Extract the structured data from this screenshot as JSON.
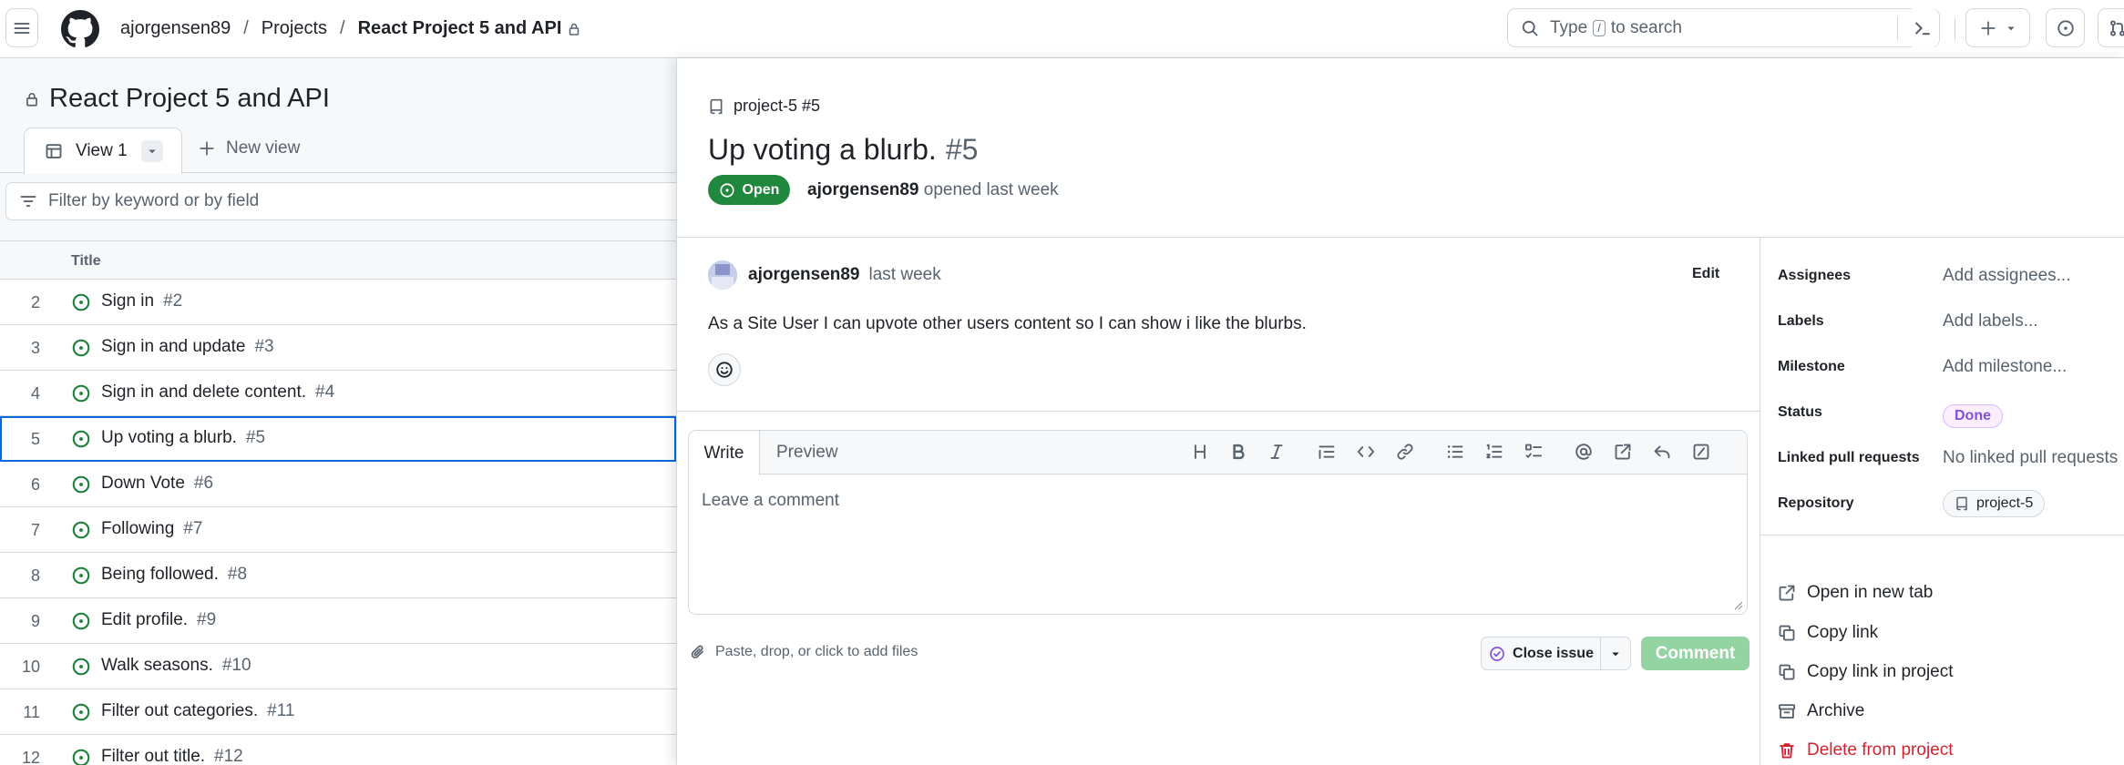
{
  "header": {
    "breadcrumb": {
      "owner": "ajorgensen89",
      "section": "Projects",
      "project": "React Project 5 and API"
    },
    "search": {
      "prefix": "Type",
      "key": "/",
      "suffix": "to search"
    }
  },
  "project": {
    "title": "React Project 5 and API",
    "tabs": {
      "view1": "View 1",
      "new_view": "New view"
    },
    "filter_placeholder": "Filter by keyword or by field",
    "table": {
      "column_title": "Title",
      "rows": [
        {
          "num": "2",
          "title": "Sign in",
          "ref": "#2"
        },
        {
          "num": "3",
          "title": "Sign in and update",
          "ref": "#3"
        },
        {
          "num": "4",
          "title": "Sign in and delete content.",
          "ref": "#4"
        },
        {
          "num": "5",
          "title": "Up voting a blurb.",
          "ref": "#5"
        },
        {
          "num": "6",
          "title": "Down Vote",
          "ref": "#6"
        },
        {
          "num": "7",
          "title": "Following",
          "ref": "#7"
        },
        {
          "num": "8",
          "title": "Being followed.",
          "ref": "#8"
        },
        {
          "num": "9",
          "title": "Edit profile.",
          "ref": "#9"
        },
        {
          "num": "10",
          "title": "Walk seasons.",
          "ref": "#10"
        },
        {
          "num": "11",
          "title": "Filter out categories.",
          "ref": "#11"
        },
        {
          "num": "12",
          "title": "Filter out title.",
          "ref": "#12"
        }
      ],
      "selected_row": "5"
    }
  },
  "issue": {
    "repo_ref": "project-5 #5",
    "title": "Up voting a blurb.",
    "number": "#5",
    "state": "Open",
    "opened_by": "ajorgensen89",
    "opened_when": "opened last week",
    "comment": {
      "author": "ajorgensen89",
      "when": "last week",
      "edit_label": "Edit",
      "body": "As a Site User I can upvote other users content so I can show i like the blurbs."
    },
    "editor": {
      "tab_write": "Write",
      "tab_preview": "Preview",
      "placeholder": "Leave a comment",
      "attach_hint": "Paste, drop, or click to add files",
      "close_issue_label": "Close issue",
      "comment_label": "Comment"
    }
  },
  "sidebar": {
    "assignees": {
      "label": "Assignees",
      "value": "Add assignees..."
    },
    "labels": {
      "label": "Labels",
      "value": "Add labels..."
    },
    "milestone": {
      "label": "Milestone",
      "value": "Add milestone..."
    },
    "status": {
      "label": "Status",
      "value": "Done"
    },
    "linked_prs": {
      "label": "Linked pull requests",
      "value": "No linked pull requests"
    },
    "repository": {
      "label": "Repository",
      "value": "project-5"
    },
    "actions": {
      "open_new_tab": "Open in new tab",
      "copy_link": "Copy link",
      "copy_link_project": "Copy link in project",
      "archive": "Archive",
      "delete": "Delete from project"
    }
  },
  "colors": {
    "open_green": "#1f883d",
    "accent_blue": "#0969da",
    "done_purple": "#8250df",
    "danger_red": "#d1242f"
  },
  "icons": [
    "hamburger-icon",
    "github-logo-icon",
    "lock-icon",
    "search-icon",
    "terminal-icon",
    "plus-icon",
    "issue-icon",
    "pull-request-icon",
    "table-icon",
    "filter-icon",
    "issue-open-icon",
    "repo-icon",
    "smiley-icon",
    "heading-icon",
    "bold-icon",
    "italic-icon",
    "quote-icon",
    "code-icon",
    "link-icon",
    "list-icon",
    "ordered-list-icon",
    "task-list-icon",
    "mention-icon",
    "reference-icon",
    "reply-icon",
    "slash-icon",
    "paperclip-icon",
    "check-circle-icon",
    "external-link-icon",
    "copy-icon",
    "archive-icon",
    "trash-icon"
  ]
}
